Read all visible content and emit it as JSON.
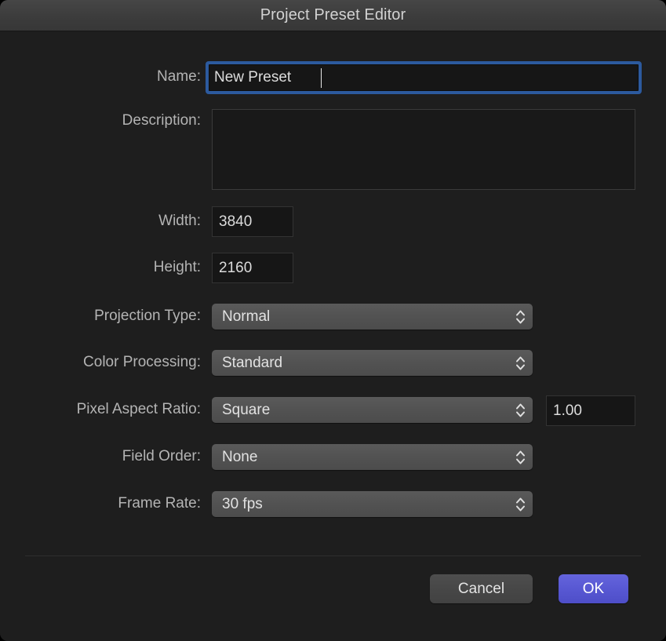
{
  "window": {
    "title": "Project Preset Editor"
  },
  "form": {
    "name": {
      "label": "Name:",
      "value": "New Preset"
    },
    "description": {
      "label": "Description:",
      "value": "",
      "placeholder": ""
    },
    "width": {
      "label": "Width:",
      "value": "3840"
    },
    "height": {
      "label": "Height:",
      "value": "2160"
    },
    "projection_type": {
      "label": "Projection Type:",
      "value": "Normal"
    },
    "color_processing": {
      "label": "Color Processing:",
      "value": "Standard"
    },
    "pixel_aspect_ratio": {
      "label": "Pixel Aspect Ratio:",
      "value": "Square",
      "numeric_value": "1.00"
    },
    "field_order": {
      "label": "Field Order:",
      "value": "None"
    },
    "frame_rate": {
      "label": "Frame Rate:",
      "value": "30 fps"
    }
  },
  "footer": {
    "cancel_label": "Cancel",
    "ok_label": "OK"
  },
  "colors": {
    "window_background": "#1e1e1e",
    "titlebar": "#3c3c3c",
    "accent_ok": "#5757d2",
    "focus_ring": "#2c5a9e",
    "label_text": "#b4b4b4",
    "popup_background": "#525252"
  }
}
